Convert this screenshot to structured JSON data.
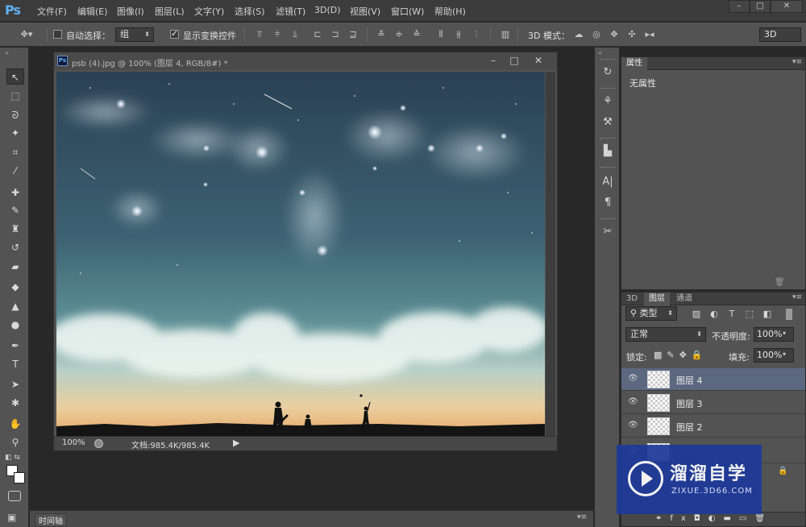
{
  "app": {
    "logo": "Ps",
    "menu": [
      "文件(F)",
      "编辑(E)",
      "图像(I)",
      "图层(L)",
      "文字(Y)",
      "选择(S)",
      "滤镜(T)",
      "3D(D)",
      "视图(V)",
      "窗口(W)",
      "帮助(H)"
    ],
    "window_controls": [
      "–",
      "□",
      "✕"
    ]
  },
  "options_bar": {
    "auto_select_label": "自动选择：",
    "auto_select_value": "组",
    "show_transform_label": "显示变换控件",
    "mode_3d_label": "3D 模式：",
    "workspace_value": "3D"
  },
  "tools": [
    {
      "name": "move-tool",
      "glyph": "↖",
      "active": true
    },
    {
      "name": "marquee-tool",
      "glyph": "⬚"
    },
    {
      "name": "lasso-tool",
      "glyph": "ᘐ"
    },
    {
      "name": "quick-select-tool",
      "glyph": "✦"
    },
    {
      "name": "crop-tool",
      "glyph": "⌗"
    },
    {
      "name": "eyedropper-tool",
      "glyph": "⁄"
    },
    {
      "name": "healing-tool",
      "glyph": "✚"
    },
    {
      "name": "brush-tool",
      "glyph": "✎"
    },
    {
      "name": "stamp-tool",
      "glyph": "♜"
    },
    {
      "name": "history-brush-tool",
      "glyph": "↺"
    },
    {
      "name": "eraser-tool",
      "glyph": "▰"
    },
    {
      "name": "bucket-tool",
      "glyph": "◆"
    },
    {
      "name": "blur-tool",
      "glyph": "▲"
    },
    {
      "name": "dodge-tool",
      "glyph": "●"
    },
    {
      "name": "pen-tool",
      "glyph": "✒"
    },
    {
      "name": "type-tool",
      "glyph": "T"
    },
    {
      "name": "path-select-tool",
      "glyph": "➤"
    },
    {
      "name": "shape-tool",
      "glyph": "✱"
    },
    {
      "name": "hand-tool",
      "glyph": "✋"
    },
    {
      "name": "zoom-tool",
      "glyph": "⚲"
    }
  ],
  "document": {
    "title": "psb (4).jpg @ 100% (图层 4, RGB/8#) *",
    "zoom": "100%",
    "doc_info": "文档:985.4K/985.4K"
  },
  "properties_panel": {
    "tab": "属性",
    "body": "无属性"
  },
  "layers_panel": {
    "tabs": [
      "3D",
      "图层",
      "通道"
    ],
    "filter_kind": "类型",
    "blend_mode": "正常",
    "opacity_label": "不透明度:",
    "opacity_value": "100%",
    "lock_label": "锁定:",
    "fill_label": "填充:",
    "fill_value": "100%",
    "layers": [
      {
        "name": "图层 4",
        "selected": true
      },
      {
        "name": "图层 3",
        "selected": false
      },
      {
        "name": "图层 2",
        "selected": false
      }
    ]
  },
  "timeline": {
    "tab": "时间轴"
  },
  "watermark": {
    "title": "溜溜自学",
    "url": "ZIXUE.3D66.COM"
  }
}
